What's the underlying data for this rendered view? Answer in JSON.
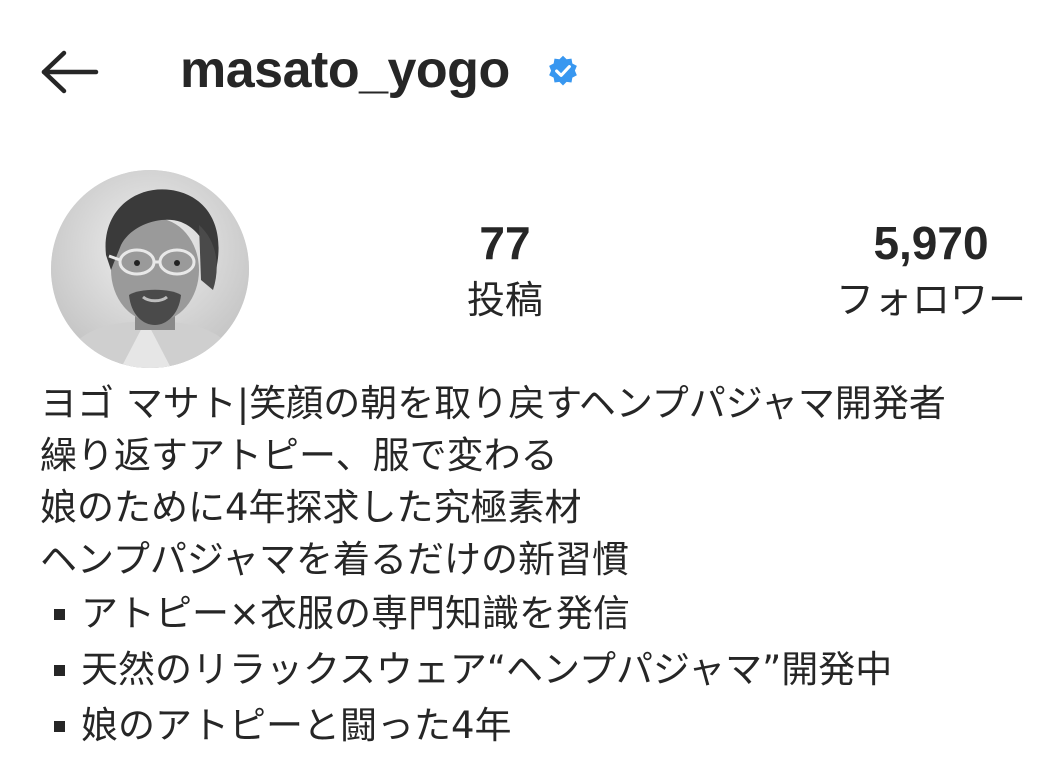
{
  "header": {
    "username": "masato_yogo",
    "verified": true,
    "back_icon": "arrow-left-icon",
    "verified_icon": "verified-badge-icon",
    "accent_color": "#3897f0"
  },
  "stats": {
    "posts": {
      "value": "77",
      "label": "投稿"
    },
    "followers": {
      "value": "5,970",
      "label": "フォロワー"
    }
  },
  "bio": {
    "lines": [
      "ヨゴ マサト|笑顔の朝を取り戻すヘンプパジャマ開発者",
      "繰り返すアトピー、服で変わる",
      "娘のために4年探求した究極素材",
      "ヘンプパジャマを着るだけの新習慣"
    ],
    "bullets": [
      "アトピー×衣服の専門知識を発信",
      "天然のリラックスウェア“ヘンプパジャマ”開発中",
      "娘のアトピーと闘った4年"
    ]
  }
}
